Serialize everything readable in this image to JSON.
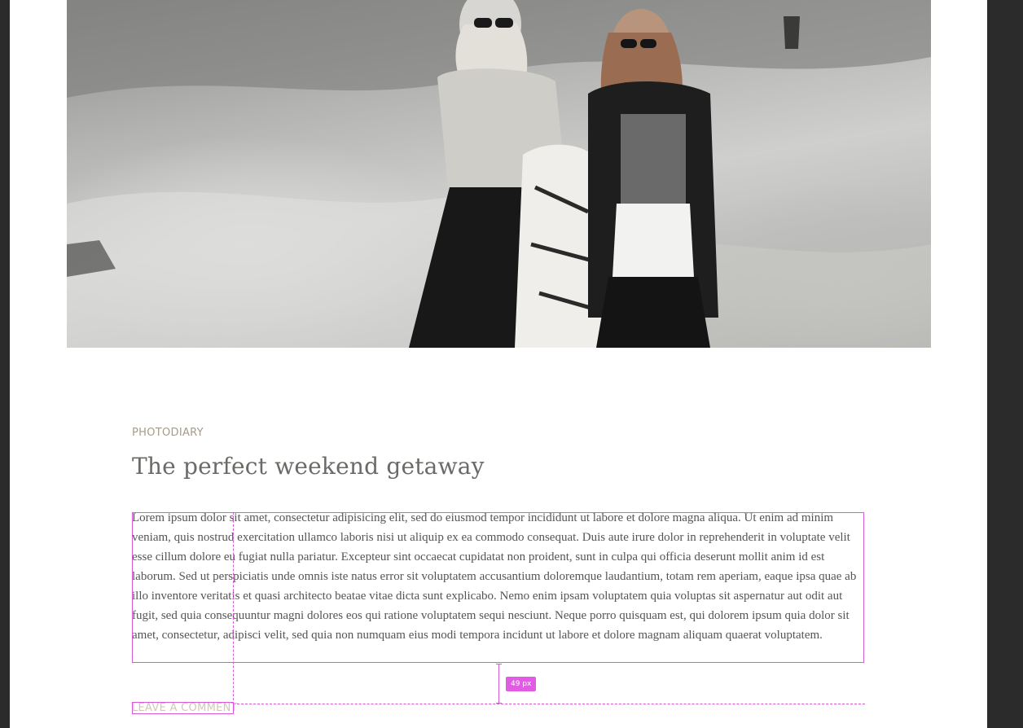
{
  "post": {
    "image_alt": "Two women in sunglasses standing on a sandy dune",
    "category": "PHOTODIARY",
    "title": "The perfect weekend getaway",
    "body": "Lorem ipsum dolor sit amet, consectetur adipisicing elit, sed do eiusmod tempor incididunt ut labore et dolore magna aliqua. Ut enim ad minim veniam, quis nostrud exercitation ullamco laboris nisi ut aliquip ex ea commodo consequat. Duis aute irure dolor in reprehenderit in voluptate velit esse cillum dolore eu fugiat nulla pariatur. Excepteur sint occaecat cupidatat non proident, sunt in culpa qui officia deserunt mollit anim id est laborum. Sed ut perspiciatis unde omnis iste natus error sit voluptatem accusantium doloremque laudantium, totam rem aperiam, eaque ipsa quae ab illo inventore veritatis et quasi architecto beatae vitae dicta sunt explicabo. Nemo enim ipsam voluptatem quia voluptas sit aspernatur aut odit aut fugit, sed quia consequuntur magni dolores eos qui ratione voluptatem sequi nesciunt. Neque porro quisquam est, qui dolorem ipsum quia dolor sit amet, consectetur, adipisci velit, sed quia non numquam eius modi tempora incidunt ut labore et dolore magnam aliquam quaerat voluptatem.",
    "comment_link": "LEAVE A COMMENT"
  },
  "editor_overlay": {
    "spacing_label": "49 px",
    "accent_color": "#e15ce3"
  }
}
